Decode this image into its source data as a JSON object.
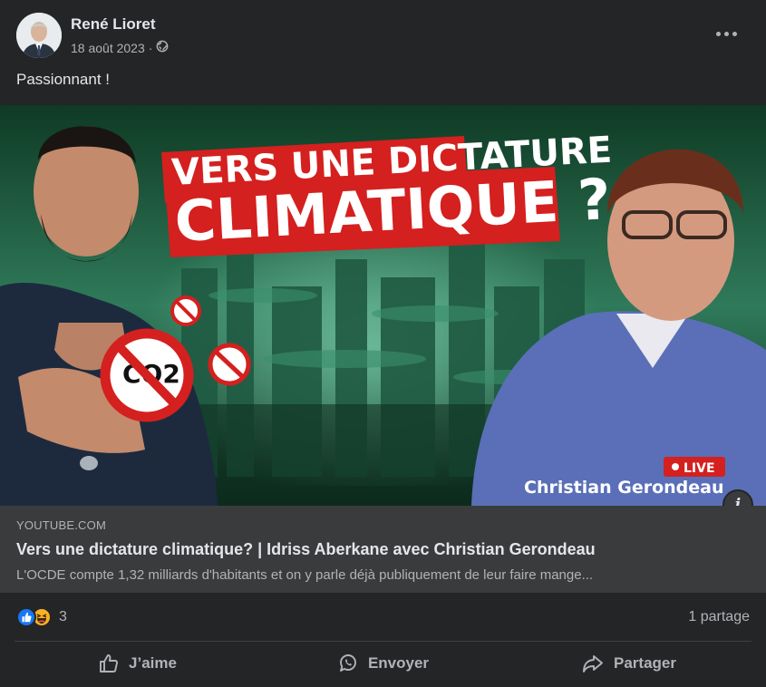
{
  "post": {
    "author": "René Lioret",
    "date": "18 août 2023",
    "privacy_icon": "globe-icon",
    "text": "Passionnant !"
  },
  "thumbnail": {
    "headline_line1": "VERS UNE DICTATURE",
    "headline_line2": "CLIMATIQUE ?",
    "co2_badge": "CO2",
    "live_label": "LIVE",
    "name_caption": "Christian Gerondeau"
  },
  "link": {
    "domain": "YOUTUBE.COM",
    "title": "Vers une dictature climatique? | Idriss Aberkane avec Christian Gerondeau",
    "description": "L'OCDE compte 1,32 milliards d'habitants et on y parle déjà publiquement de leur faire mange..."
  },
  "stats": {
    "reaction_count": "3",
    "shares": "1 partage"
  },
  "actions": {
    "like": "J’aime",
    "send": "Envoyer",
    "share": "Partager"
  },
  "colors": {
    "background": "#242526",
    "link_box": "#3a3b3c",
    "like_blue": "#1877f2",
    "headline_red": "#d4201f",
    "live_red": "#d4201f"
  }
}
